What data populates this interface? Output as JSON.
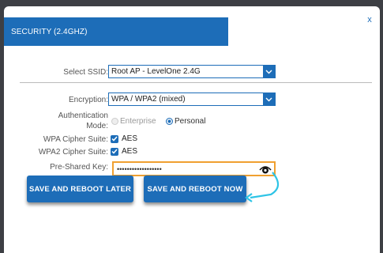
{
  "modal": {
    "title": "SECURITY (2.4GHZ)",
    "close": "x"
  },
  "form": {
    "ssid_label": "Select SSID:",
    "ssid_value": "Root AP - LevelOne 2.4G",
    "encryption_label": "Encryption:",
    "encryption_value": "WPA / WPA2 (mixed)",
    "auth_label_1": "Authentication",
    "auth_label_2": "Mode:",
    "auth_options": [
      "Enterprise",
      "Personal"
    ],
    "auth_selected": "Personal",
    "wpa_cipher_label": "WPA Cipher Suite:",
    "wpa_cipher_value": "AES",
    "wpa2_cipher_label": "WPA2 Cipher Suite:",
    "wpa2_cipher_value": "AES",
    "psk_label": "Pre-Shared Key:",
    "psk_value": "••••••••••••••••••"
  },
  "buttons": {
    "save_later": "SAVE AND REBOOT LATER",
    "save_now": "SAVE AND REBOOT NOW"
  },
  "colors": {
    "accent": "#1d6db8",
    "highlight": "#f0a030",
    "arrow": "#2ec4e6"
  }
}
